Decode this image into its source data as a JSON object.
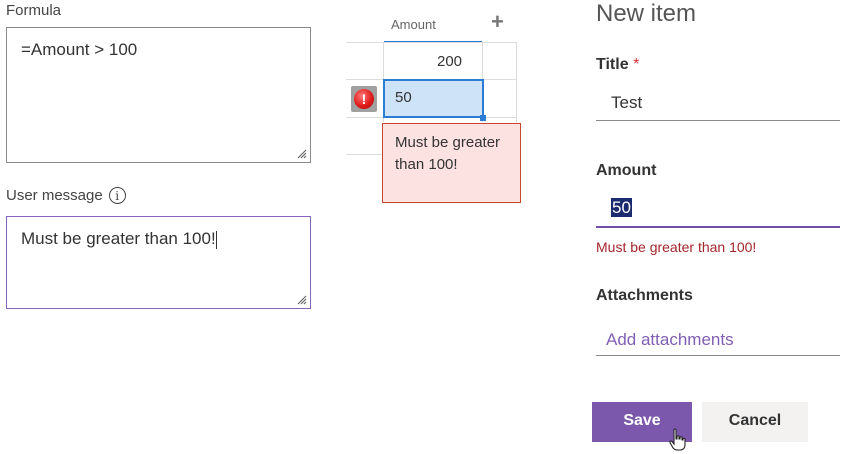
{
  "formula": {
    "label": "Formula",
    "value": "=Amount > 100"
  },
  "user_message": {
    "label": "User message",
    "value": "Must be greater than 100!"
  },
  "grid": {
    "column_header": "Amount",
    "add_column": "+",
    "rows": [
      {
        "amount": "200"
      },
      {
        "amount": "50",
        "error": true
      }
    ],
    "error_icon": "!",
    "tooltip": "Must be greater than 100!"
  },
  "form": {
    "title": "New item",
    "fields": {
      "title": {
        "label": "Title",
        "required_mark": "*",
        "value": "Test"
      },
      "amount": {
        "label": "Amount",
        "value": "50",
        "error": "Must be greater than 100!"
      },
      "attachments": {
        "label": "Attachments",
        "link": "Add attachments"
      }
    },
    "save_label": "Save",
    "cancel_label": "Cancel"
  },
  "icons": {
    "info": "info-icon",
    "error": "error-icon",
    "resize_grip": "resize-grip-icon",
    "cursor": "hand-cursor-icon"
  },
  "colors": {
    "accent": "#7b58ac",
    "error": "#a4262c",
    "selection": "#2b7cd3"
  }
}
